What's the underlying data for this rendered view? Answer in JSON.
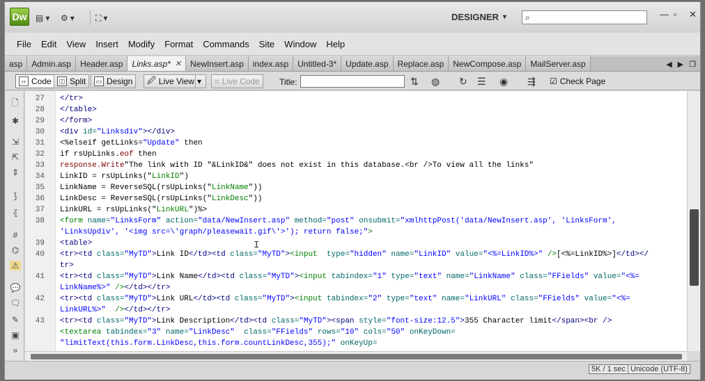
{
  "titlebar": {
    "logo": "Dw",
    "workspace": "DESIGNER",
    "search_placeholder": ""
  },
  "menu": [
    "File",
    "Edit",
    "View",
    "Insert",
    "Modify",
    "Format",
    "Commands",
    "Site",
    "Window",
    "Help"
  ],
  "tabs": [
    {
      "label": "asp",
      "active": false
    },
    {
      "label": "Admin.asp",
      "active": false
    },
    {
      "label": "Header.asp",
      "active": false
    },
    {
      "label": "Links.asp*",
      "active": true
    },
    {
      "label": "NewInsert.asp",
      "active": false
    },
    {
      "label": "index.asp",
      "active": false
    },
    {
      "label": "Untitled-3*",
      "active": false
    },
    {
      "label": "Update.asp",
      "active": false
    },
    {
      "label": "Replace.asp",
      "active": false
    },
    {
      "label": "NewCompose.asp",
      "active": false
    },
    {
      "label": "MailServer.asp",
      "active": false
    }
  ],
  "doc_toolbar": {
    "code": "Code",
    "split": "Split",
    "design": "Design",
    "live_view": "Live View",
    "live_code": "Live Code",
    "title_label": "Title:",
    "title_value": "",
    "check_page": "Check Page"
  },
  "code_lines": [
    {
      "n": "27",
      "segs": [
        [
          "c-tag",
          "</tr>"
        ]
      ]
    },
    {
      "n": "28",
      "segs": [
        [
          "c-tag",
          "</table>"
        ]
      ]
    },
    {
      "n": "29",
      "segs": [
        [
          "c-tag",
          "</form>"
        ]
      ]
    },
    {
      "n": "30",
      "segs": [
        [
          "c-tag",
          "<div "
        ],
        [
          "c-attr",
          "id="
        ],
        [
          "c-val",
          "\"Linksdiv\""
        ],
        [
          "c-tag",
          "></div>"
        ]
      ]
    },
    {
      "n": "31",
      "segs": [
        [
          "c-pl",
          "<%elseif getLinks="
        ],
        [
          "c-val",
          "\"Update\""
        ],
        [
          "c-pl",
          " then"
        ]
      ]
    },
    {
      "n": "32",
      "segs": [
        [
          "c-pl",
          "if rsUpLinks."
        ],
        [
          "c-asp",
          "eof"
        ],
        [
          "c-pl",
          " then"
        ]
      ]
    },
    {
      "n": "33",
      "segs": [
        [
          "c-asp",
          "response.Write"
        ],
        [
          "c-pl",
          "\"The link with ID \"&LinkID&\" does not exist in this database.<br />To view all the links\""
        ]
      ]
    },
    {
      "n": "34",
      "segs": [
        [
          "c-pl",
          "LinkID = rsUpLinks(\""
        ],
        [
          "c-grn",
          "LinkID"
        ],
        [
          "c-pl",
          "\")"
        ]
      ]
    },
    {
      "n": "35",
      "segs": [
        [
          "c-pl",
          "LinkName = ReverseSQL(rsUpLinks(\""
        ],
        [
          "c-grn",
          "LinkName"
        ],
        [
          "c-pl",
          "\"))"
        ]
      ]
    },
    {
      "n": "36",
      "segs": [
        [
          "c-pl",
          "LinkDesc = ReverseSQL(rsUpLinks(\""
        ],
        [
          "c-grn",
          "LinkDesc"
        ],
        [
          "c-pl",
          "\"))"
        ]
      ]
    },
    {
      "n": "37",
      "segs": [
        [
          "c-pl",
          "LinkURL = rsUpLinks(\""
        ],
        [
          "c-grn",
          "LinkURL"
        ],
        [
          "c-pl",
          "\")%>"
        ]
      ]
    },
    {
      "n": "38",
      "segs": [
        [
          "c-str",
          "<form "
        ],
        [
          "c-attr",
          "name="
        ],
        [
          "c-val",
          "\"LinksForm\""
        ],
        [
          "c-attr",
          " action="
        ],
        [
          "c-val",
          "\"data/NewInsert.asp\""
        ],
        [
          "c-attr",
          " method="
        ],
        [
          "c-val",
          "\"post\""
        ],
        [
          "c-attr",
          " onsubmit="
        ],
        [
          "c-val",
          "\"xmlhttpPost('data/NewInsert.asp', 'LinksForm',"
        ]
      ]
    },
    {
      "n": "",
      "segs": [
        [
          "c-val",
          "'LinksUpdiv', '<img src=\\'graph/pleasewait.gif\\'>'); return false;\""
        ],
        [
          "c-str",
          ">"
        ]
      ]
    },
    {
      "n": "39",
      "segs": [
        [
          "c-tag",
          "<table>"
        ]
      ]
    },
    {
      "n": "40",
      "segs": [
        [
          "c-tag",
          "<tr><td "
        ],
        [
          "c-attr",
          "class="
        ],
        [
          "c-val",
          "\"MyTD\""
        ],
        [
          "c-tag",
          ">"
        ],
        [
          "c-pl",
          "Link ID"
        ],
        [
          "c-tag",
          "</td><td "
        ],
        [
          "c-attr",
          "class="
        ],
        [
          "c-val",
          "\"MyTD\""
        ],
        [
          "c-tag",
          ">"
        ],
        [
          "c-str",
          "<input  "
        ],
        [
          "c-attr",
          "type="
        ],
        [
          "c-val",
          "\"hidden\""
        ],
        [
          "c-attr",
          " name="
        ],
        [
          "c-val",
          "\"LinkID\""
        ],
        [
          "c-attr",
          " value="
        ],
        [
          "c-val",
          "\"<%=LinkID%>\""
        ],
        [
          "c-str",
          " />"
        ],
        [
          "c-pl",
          "[<%=LinkID%>]"
        ],
        [
          "c-tag",
          "</td></"
        ]
      ]
    },
    {
      "n": "",
      "segs": [
        [
          "c-tag",
          "tr>"
        ]
      ]
    },
    {
      "n": "41",
      "segs": [
        [
          "c-tag",
          "<tr><td "
        ],
        [
          "c-attr",
          "class="
        ],
        [
          "c-val",
          "\"MyTD\""
        ],
        [
          "c-tag",
          ">"
        ],
        [
          "c-pl",
          "Link Name"
        ],
        [
          "c-tag",
          "</td><td "
        ],
        [
          "c-attr",
          "class="
        ],
        [
          "c-val",
          "\"MyTD\""
        ],
        [
          "c-tag",
          ">"
        ],
        [
          "c-str",
          "<input "
        ],
        [
          "c-attr",
          "tabindex="
        ],
        [
          "c-val",
          "\"1\""
        ],
        [
          "c-attr",
          " type="
        ],
        [
          "c-val",
          "\"text\""
        ],
        [
          "c-attr",
          " name="
        ],
        [
          "c-val",
          "\"LinkName\""
        ],
        [
          "c-attr",
          " class="
        ],
        [
          "c-val",
          "\"FFields\""
        ],
        [
          "c-attr",
          " value="
        ],
        [
          "c-val",
          "\"<%="
        ]
      ]
    },
    {
      "n": "",
      "segs": [
        [
          "c-val",
          "LinkName%>\""
        ],
        [
          "c-str",
          " />"
        ],
        [
          "c-tag",
          "</td></tr>"
        ]
      ]
    },
    {
      "n": "42",
      "segs": [
        [
          "c-tag",
          "<tr><td "
        ],
        [
          "c-attr",
          "class="
        ],
        [
          "c-val",
          "\"MyTD\""
        ],
        [
          "c-tag",
          ">"
        ],
        [
          "c-pl",
          "Link URL"
        ],
        [
          "c-tag",
          "</td><td "
        ],
        [
          "c-attr",
          "class="
        ],
        [
          "c-val",
          "\"MyTD\""
        ],
        [
          "c-tag",
          ">"
        ],
        [
          "c-str",
          "<input "
        ],
        [
          "c-attr",
          "tabindex="
        ],
        [
          "c-val",
          "\"2\""
        ],
        [
          "c-attr",
          " type="
        ],
        [
          "c-val",
          "\"text\""
        ],
        [
          "c-attr",
          " name="
        ],
        [
          "c-val",
          "\"LinkURL\""
        ],
        [
          "c-attr",
          " class="
        ],
        [
          "c-val",
          "\"FFields\""
        ],
        [
          "c-attr",
          " value="
        ],
        [
          "c-val",
          "\"<%="
        ]
      ]
    },
    {
      "n": "",
      "segs": [
        [
          "c-val",
          "LinkURL%>\""
        ],
        [
          "c-str",
          "  />"
        ],
        [
          "c-tag",
          "</td></tr>"
        ]
      ]
    },
    {
      "n": "43",
      "segs": [
        [
          "c-tag",
          "<tr><td "
        ],
        [
          "c-attr",
          "class="
        ],
        [
          "c-val",
          "\"MyTD\""
        ],
        [
          "c-tag",
          ">"
        ],
        [
          "c-pl",
          "Link Description"
        ],
        [
          "c-tag",
          "</td><td "
        ],
        [
          "c-attr",
          "class="
        ],
        [
          "c-val",
          "\"MyTD\""
        ],
        [
          "c-tag",
          ">"
        ],
        [
          "c-tag",
          "<span "
        ],
        [
          "c-attr",
          "style="
        ],
        [
          "c-val",
          "\"font-size:12.5\""
        ],
        [
          "c-tag",
          ">"
        ],
        [
          "c-pl",
          "355 Character limit"
        ],
        [
          "c-tag",
          "</span><br />"
        ]
      ]
    },
    {
      "n": "",
      "segs": [
        [
          "c-str",
          "<textarea "
        ],
        [
          "c-attr",
          "tabindex="
        ],
        [
          "c-val",
          "\"3\""
        ],
        [
          "c-attr",
          " name="
        ],
        [
          "c-val",
          "\"LinkDesc\""
        ],
        [
          "c-attr",
          "  class="
        ],
        [
          "c-val",
          "\"FFields\""
        ],
        [
          "c-attr",
          " rows="
        ],
        [
          "c-val",
          "\"10\""
        ],
        [
          "c-attr",
          " cols="
        ],
        [
          "c-val",
          "\"50\""
        ],
        [
          "c-attr",
          " onKeyDown="
        ]
      ]
    },
    {
      "n": "",
      "segs": [
        [
          "c-val",
          "\"limitText(this.form.LinkDesc,this.form.countLinkDesc,355);\""
        ],
        [
          "c-attr",
          " onKeyUp="
        ]
      ]
    }
  ],
  "status": {
    "size": "5K / 1 sec",
    "encoding": "Unicode (UTF-8)"
  }
}
